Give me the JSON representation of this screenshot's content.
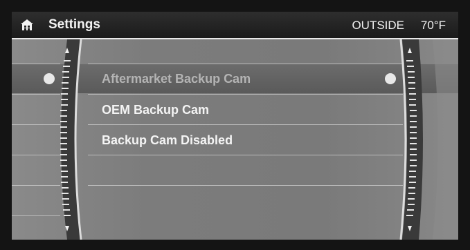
{
  "header": {
    "title": "Settings",
    "icon": "home-icon",
    "outside_label": "OUTSIDE",
    "outside_temp": "70°F"
  },
  "menu": {
    "items": [
      {
        "label": "Aftermarket Backup Cam",
        "selected": true
      },
      {
        "label": "OEM Backup Cam",
        "selected": false
      },
      {
        "label": "Backup Cam Disabled",
        "selected": false
      }
    ]
  },
  "colors": {
    "header_bg": "#1f1f1f",
    "screen_bg": "#7d7d7d",
    "selected_bar": "#606060",
    "text": "#f4f4f4",
    "text_dim": "#b4b4b4"
  }
}
